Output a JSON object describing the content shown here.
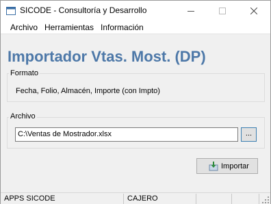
{
  "window": {
    "title": "SICODE - Consultoría y Desarrollo"
  },
  "menu": {
    "items": [
      "Archivo",
      "Herramientas",
      "Información"
    ]
  },
  "heading": "Importador Vtas. Most. (DP)",
  "formato": {
    "label": "Formato",
    "text": "Fecha, Folio, Almacén, Importe (con Impto)"
  },
  "archivo": {
    "label": "Archivo",
    "path": "C:\\Ventas de Mostrador.xlsx",
    "browse_label": "..."
  },
  "actions": {
    "import_label": "Importar"
  },
  "status": {
    "panels": [
      "APPS SICODE",
      "CAJERO",
      "",
      ""
    ]
  },
  "colors": {
    "heading": "#4d78a8",
    "window_bg": "#f0f0f0"
  }
}
